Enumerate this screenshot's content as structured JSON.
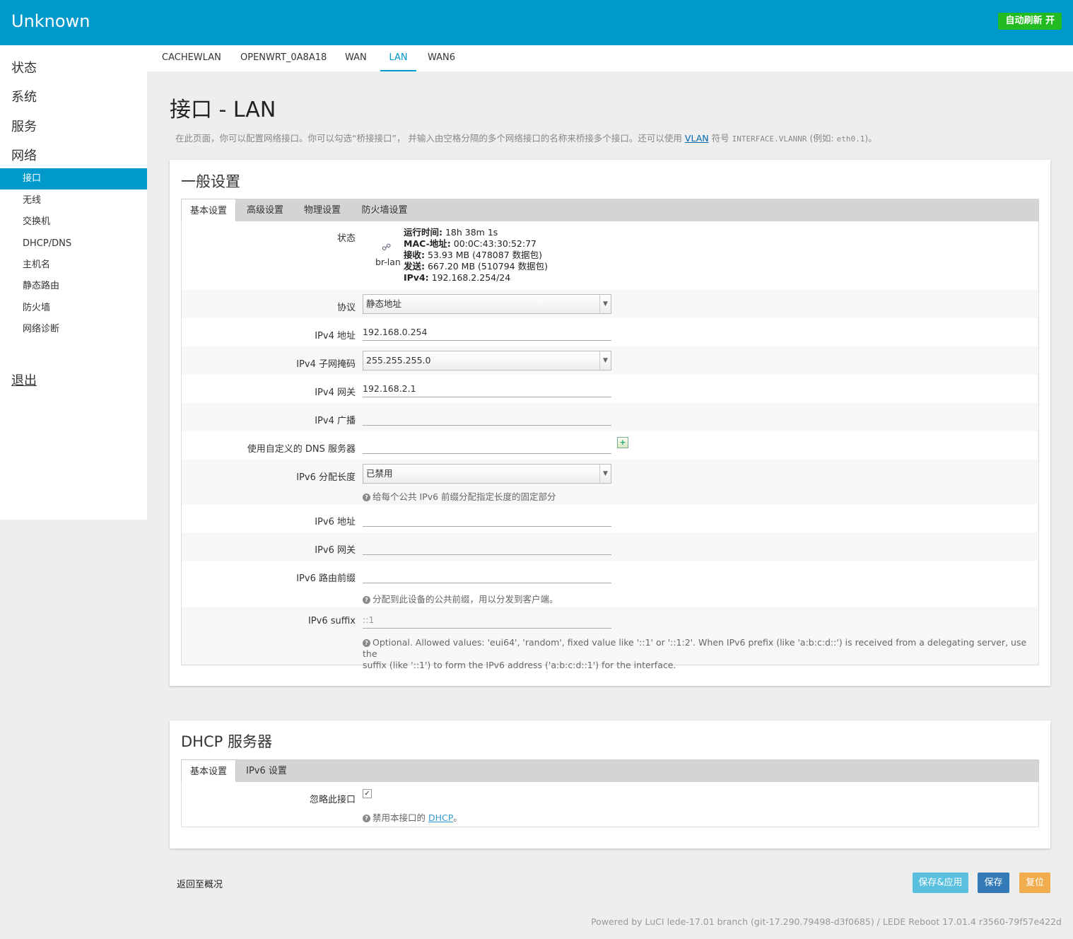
{
  "header": {
    "brand": "Unknown",
    "autorefresh": "自动刷新 开"
  },
  "sidebar": {
    "categories": [
      "状态",
      "系统",
      "服务",
      "网络"
    ],
    "items": [
      "接口",
      "无线",
      "交换机",
      "DHCP/DNS",
      "主机名",
      "静态路由",
      "防火墙",
      "网络诊断"
    ],
    "logout": "退出"
  },
  "topnav": {
    "tabs": [
      "CACHEWLAN",
      "OPENWRT_0A8A18",
      "WAN",
      "LAN",
      "WAN6"
    ],
    "active": "LAN"
  },
  "page": {
    "title": "接口 - LAN",
    "desc_before": "在此页面，你可以配置网络接口。你可以勾选“桥接接口”， 并输入由空格分隔的多个网络接口的名称来桥接多个接口。还可以使用 ",
    "desc_link": "VLAN",
    "desc_mid": " 符号 ",
    "desc_code": "INTERFACE.VLANNR",
    "desc_paren_open": " (例如: ",
    "desc_code2": "eth0.1",
    "desc_end": ")。"
  },
  "general": {
    "title": "一般设置",
    "tabs": [
      "基本设置",
      "高级设置",
      "物理设置",
      "防火墙设置"
    ],
    "status": {
      "label": "状态",
      "device": "br-lan",
      "uptime_key": "运行时间:",
      "uptime": " 18h 38m 1s",
      "mac_key": "MAC-地址:",
      "mac": " 00:0C:43:30:52:77",
      "rx_key": "接收:",
      "rx": " 53.93 MB (478087 数据包)",
      "tx_key": "发送:",
      "tx": " 667.20 MB (510794 数据包)",
      "ipv4_key": "IPv4:",
      "ipv4": " 192.168.2.254/24"
    },
    "protocol": {
      "label": "协议",
      "value": "静态地址"
    },
    "ipv4_addr": {
      "label": "IPv4 地址",
      "value": "192.168.0.254"
    },
    "ipv4_mask": {
      "label": "IPv4 子网掩码",
      "value": "255.255.255.0"
    },
    "ipv4_gw": {
      "label": "IPv4 网关",
      "value": "192.168.2.1"
    },
    "ipv4_bcast": {
      "label": "IPv4 广播",
      "value": ""
    },
    "dns": {
      "label": "使用自定义的 DNS 服务器",
      "value": ""
    },
    "ipv6_assign": {
      "label": "IPv6 分配长度",
      "value": "已禁用",
      "help": "给每个公共 IPv6 前缀分配指定长度的固定部分"
    },
    "ipv6_addr": {
      "label": "IPv6 地址",
      "value": ""
    },
    "ipv6_gw": {
      "label": "IPv6 网关",
      "value": ""
    },
    "ipv6_prefix": {
      "label": "IPv6 路由前缀",
      "value": "",
      "help": "分配到此设备的公共前缀，用以分发到客户端。"
    },
    "ipv6_suffix": {
      "label": "IPv6 suffix",
      "placeholder": "::1",
      "help_line1": "Optional. Allowed values: 'eui64', 'random', fixed value like '::1' or '::1:2'. When IPv6 prefix (like 'a:b:c:d::') is received from a delegating server, use the",
      "help_line2": "suffix (like '::1') to form the IPv6 address ('a:b:c:d::1') for the interface."
    }
  },
  "dhcp": {
    "title": "DHCP 服务器",
    "tabs": [
      "基本设置",
      "IPv6 设置"
    ],
    "ignore": {
      "label": "忽略此接口",
      "checked": true,
      "help_before": "禁用本接口的 ",
      "help_link": "DHCP",
      "help_after": "。"
    }
  },
  "actions": {
    "back": "返回至概况",
    "save_apply": "保存&应用",
    "save": "保存",
    "reset": "复位"
  },
  "footer": "Powered by LuCI lede-17.01 branch (git-17.290.79498-d3f0685) / LEDE Reboot 17.01.4 r3560-79f57e422d",
  "colors": {
    "accent": "#0099cc",
    "autorefresh": "#22bb22",
    "save_apply": "#5bc0de",
    "save": "#337ab7",
    "reset": "#f0ad4e"
  }
}
